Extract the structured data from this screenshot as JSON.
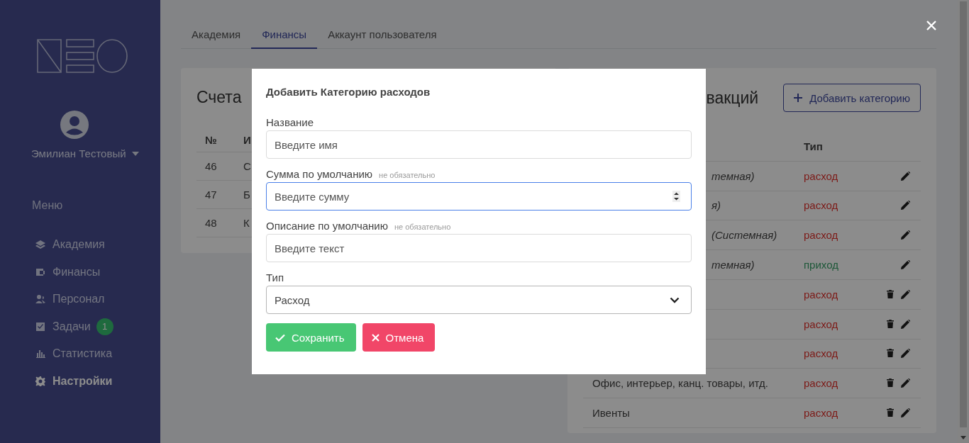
{
  "sidebar": {
    "user_name": "Эмилиан Тестовый",
    "menu_heading": "Меню",
    "items": [
      {
        "label": "Академия",
        "selected": false
      },
      {
        "label": "Финансы",
        "selected": false
      },
      {
        "label": "Персонал",
        "selected": false
      },
      {
        "label": "Задачи",
        "badge": "1",
        "selected": false
      },
      {
        "label": "Статистика",
        "selected": false
      },
      {
        "label": "Настройки",
        "selected": true
      }
    ]
  },
  "tabs": [
    {
      "label": "Академия",
      "selected": false
    },
    {
      "label": "Финансы",
      "selected": true
    },
    {
      "label": "Аккаунт пользователя",
      "selected": false
    }
  ],
  "accounts": {
    "title": "Счета",
    "columns": [
      "№",
      "И"
    ],
    "rows": [
      [
        "46",
        "С"
      ],
      [
        "47",
        "Б"
      ],
      [
        "48",
        "К"
      ]
    ]
  },
  "categories": {
    "title": "вакций",
    "add_button": "Добавить категорию",
    "columns": [
      "Тип"
    ],
    "rows": [
      {
        "name": "темная)",
        "system": true,
        "type": "расход",
        "kind": "expense"
      },
      {
        "name": "я)",
        "system": true,
        "type": "расход",
        "kind": "expense"
      },
      {
        "name": "(Системная)",
        "system": true,
        "type": "расход",
        "kind": "expense"
      },
      {
        "name": "темная)",
        "system": true,
        "type": "приход",
        "kind": "income"
      },
      {
        "system": false,
        "type": "расход",
        "kind": "expense"
      },
      {
        "system": false,
        "type": "расход",
        "kind": "expense"
      },
      {
        "system": false,
        "type": "расход",
        "kind": "expense"
      },
      {
        "name": "Офис, интерьер, канц. товары, итд.",
        "system": false,
        "type": "расход",
        "kind": "expense"
      },
      {
        "name": "Ивенты",
        "system": false,
        "type": "расход",
        "kind": "expense"
      }
    ]
  },
  "modal": {
    "title": "Добавить Категорию расходов",
    "fields": [
      {
        "kind": "text",
        "label": "Название",
        "placeholder": "Введите имя",
        "focused": false
      },
      {
        "kind": "number",
        "label": "Сумма по умолчанию",
        "hint": "не обязательно",
        "placeholder": "Введите сумму",
        "focused": true
      },
      {
        "kind": "text",
        "label": "Описание по умолчанию",
        "hint": "не обязательно",
        "placeholder": "Введите текст",
        "focused": false
      },
      {
        "kind": "select",
        "label": "Тип",
        "value": "Расход",
        "focused": false
      }
    ],
    "buttons": [
      {
        "kind": "save",
        "label": "Сохранить"
      },
      {
        "kind": "cancel",
        "label": "Отмена"
      }
    ]
  }
}
